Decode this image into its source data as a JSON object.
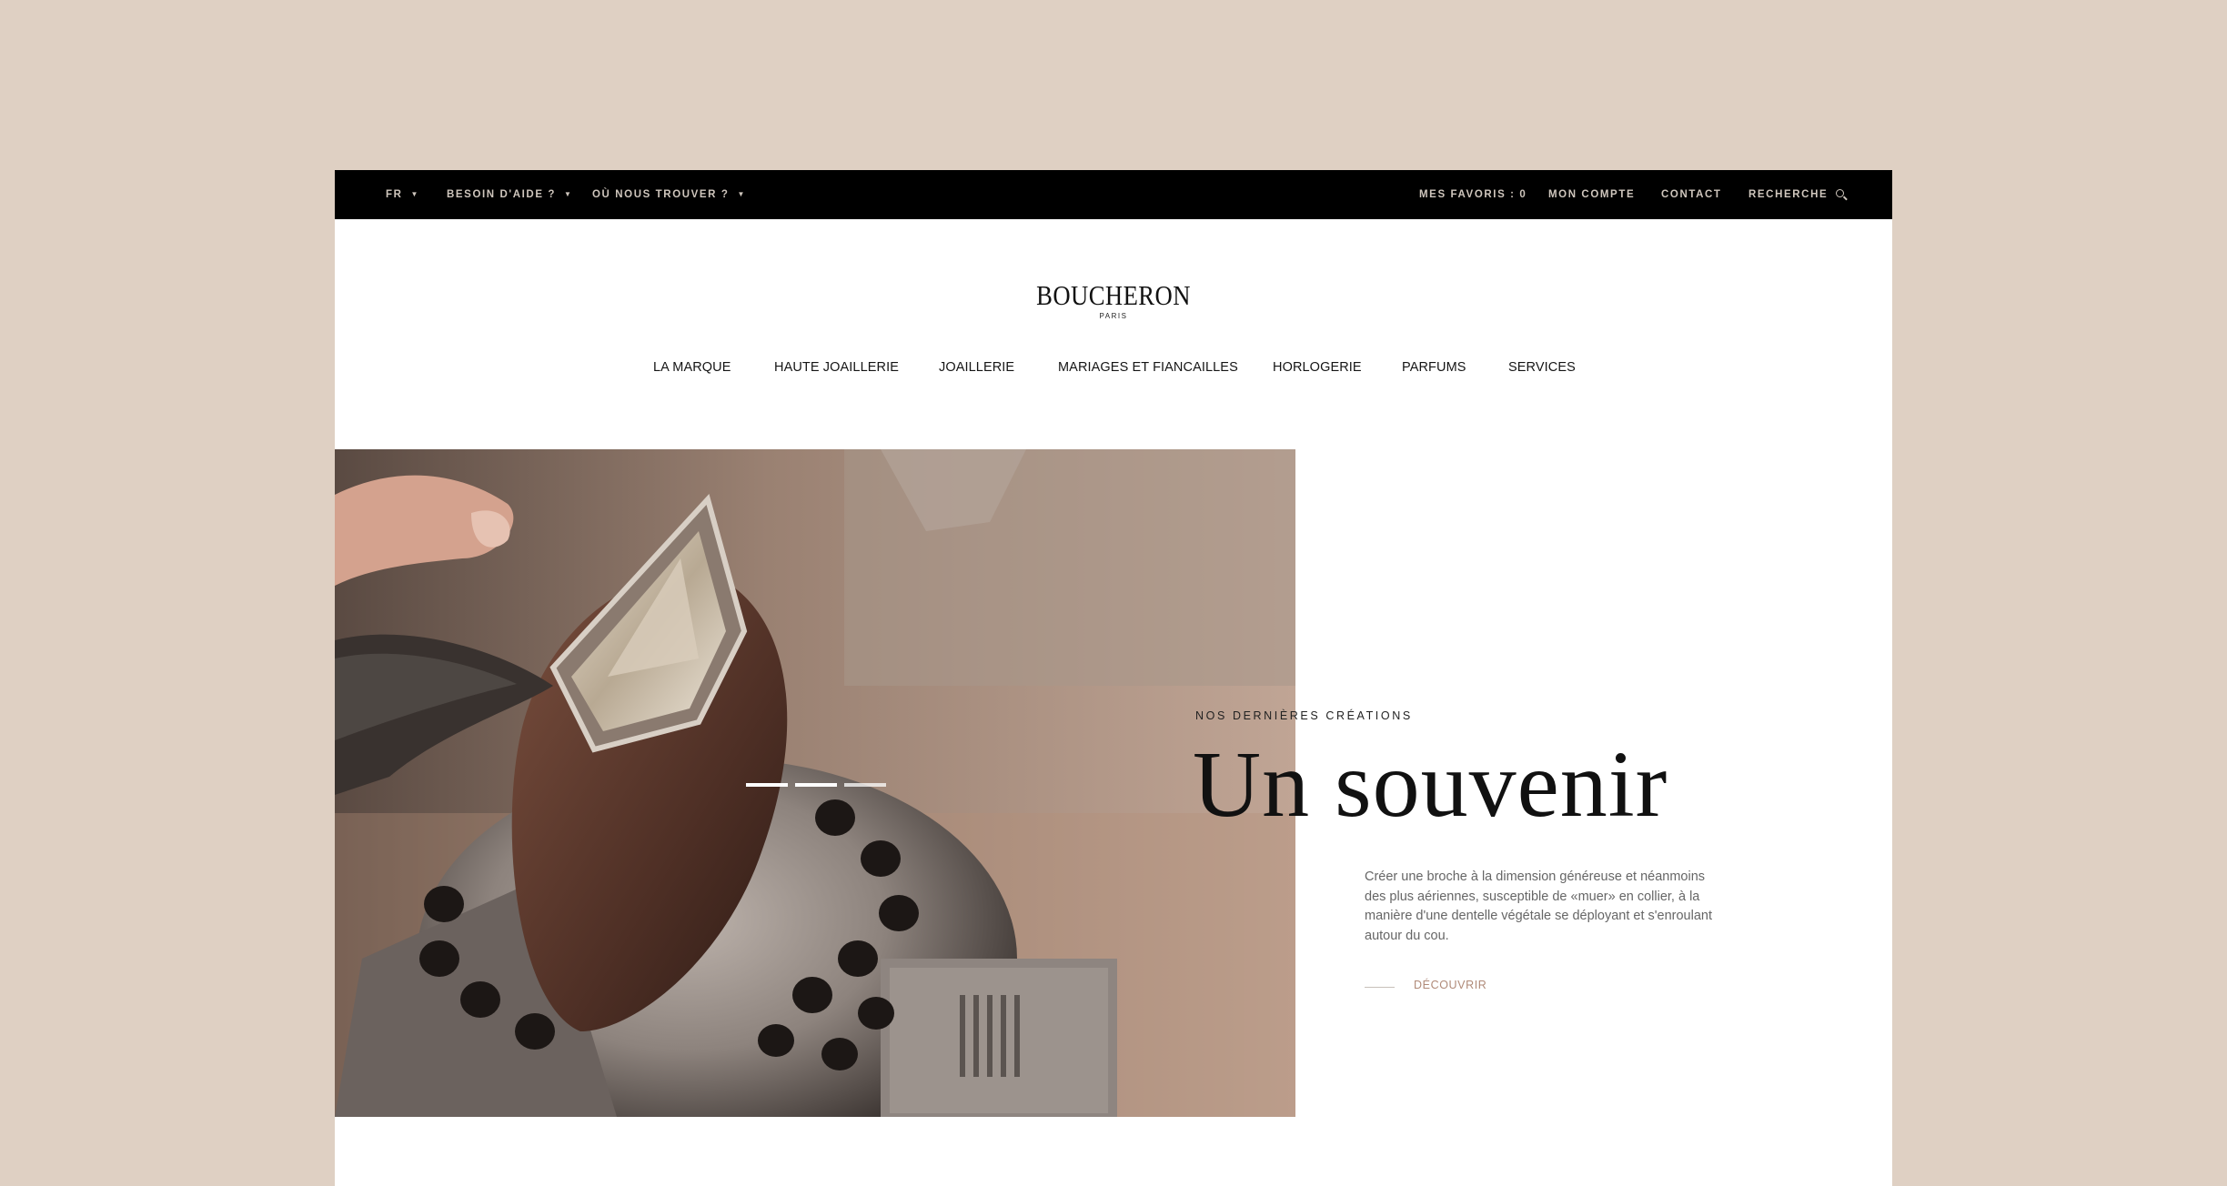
{
  "topbar": {
    "lang": "FR",
    "help": "BESOIN D'AIDE ?",
    "stores": "OÙ NOUS TROUVER ?",
    "favorites": "MES FAVORIS : 0",
    "account": "MON COMPTE",
    "contact": "CONTACT",
    "search": "RECHERCHE"
  },
  "logo": {
    "name": "BOUCHERON",
    "city": "PARIS"
  },
  "nav": {
    "items": [
      {
        "label": "LA MARQUE"
      },
      {
        "label": "HAUTE JOAILLERIE"
      },
      {
        "label": "JOAILLERIE"
      },
      {
        "label": "MARIAGES ET FIANCAILLES"
      },
      {
        "label": "HORLOGERIE"
      },
      {
        "label": "PARFUMS"
      },
      {
        "label": "SERVICES"
      }
    ]
  },
  "hero": {
    "kicker": "NOS DERNIÈRES CRÉATIONS",
    "title": "Un souvenir",
    "description": "Créer une broche à la dimension généreuse et néanmoins des plus aériennes, susceptible de «muer» en collier, à la manière d'une dentelle végétale se déployant et s'enroulant autour du cou.",
    "cta": "DÉCOUVRIR",
    "slides": 3,
    "active_slide": 3
  },
  "colors": {
    "background": "#dfd0c3",
    "topbar": "#000000",
    "accent": "#b08a78"
  }
}
